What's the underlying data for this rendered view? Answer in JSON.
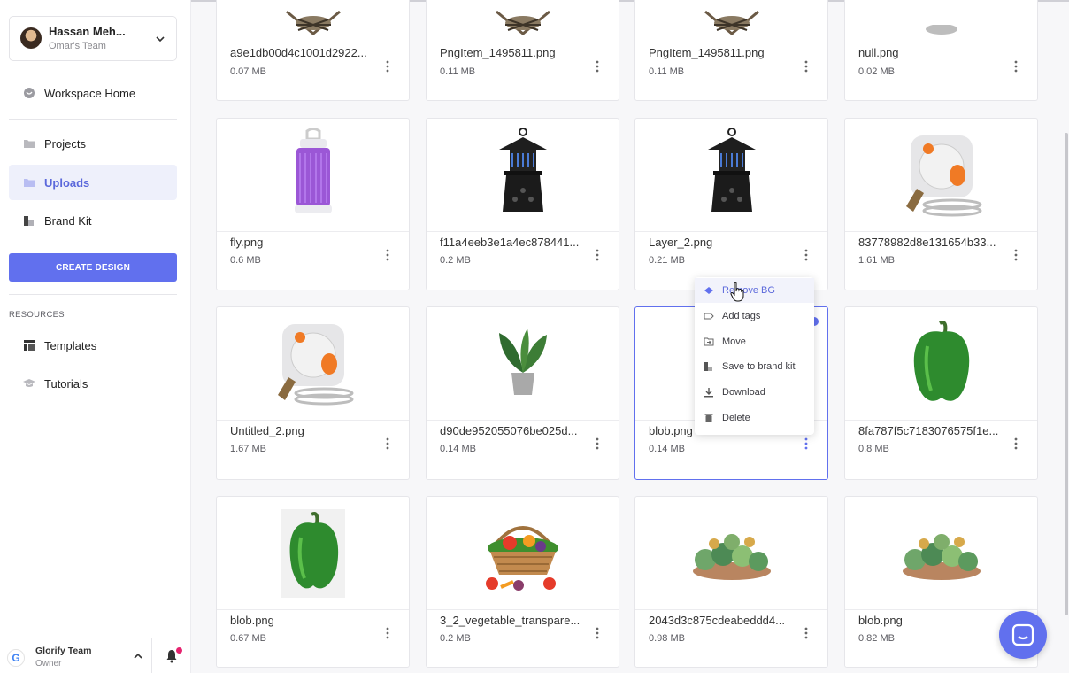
{
  "user": {
    "name": "Hassan Meh...",
    "team": "Omar's Team"
  },
  "nav": {
    "workspace_home": "Workspace Home",
    "projects": "Projects",
    "uploads": "Uploads",
    "brand_kit": "Brand Kit",
    "create_design": "CREATE DESIGN",
    "resources_label": "RESOURCES",
    "templates": "Templates",
    "tutorials": "Tutorials"
  },
  "team": {
    "name": "Glorify Team",
    "role": "Owner",
    "logo_letter": "G"
  },
  "files": [
    {
      "name": "a9e1db00d4c1001d2922...",
      "size": "0.07 MB",
      "thumb": "insect-trap"
    },
    {
      "name": "PngItem_1495811.png",
      "size": "0.11 MB",
      "thumb": "insect-trap"
    },
    {
      "name": "PngItem_1495811.png",
      "size": "0.11 MB",
      "thumb": "insect-trap"
    },
    {
      "name": "null.png",
      "size": "0.02 MB",
      "thumb": "grey-disc"
    },
    {
      "name": "fly.png",
      "size": "0.6 MB",
      "thumb": "uv-lamp"
    },
    {
      "name": "f11a4eeb3e1a4ec878441...",
      "size": "0.2 MB",
      "thumb": "lantern-trap"
    },
    {
      "name": "Layer_2.png",
      "size": "0.21 MB",
      "thumb": "lantern-trap"
    },
    {
      "name": "83778982d8e131654b33...",
      "size": "1.61 MB",
      "thumb": "hose-reel"
    },
    {
      "name": "Untitled_2.png",
      "size": "1.67 MB",
      "thumb": "hose-reel"
    },
    {
      "name": "d90de952055076be025d...",
      "size": "0.14 MB",
      "thumb": "potted-plant"
    },
    {
      "name": "blob.png",
      "size": "0.14 MB",
      "thumb": "empty"
    },
    {
      "name": "8fa787f5c7183076575f1e...",
      "size": "0.8 MB",
      "thumb": "green-pepper"
    },
    {
      "name": "blob.png",
      "size": "0.67 MB",
      "thumb": "green-pepper-boxed"
    },
    {
      "name": "3_2_vegetable_transpare...",
      "size": "0.2 MB",
      "thumb": "vegetable-basket"
    },
    {
      "name": "2043d3c875cdeabeddd4...",
      "size": "0.98 MB",
      "thumb": "succulents"
    },
    {
      "name": "blob.png",
      "size": "0.82 MB",
      "thumb": "succulents"
    }
  ],
  "context_menu": {
    "remove_bg": "Remove BG",
    "add_tags": "Add tags",
    "move": "Move",
    "save_brand_kit": "Save to brand kit",
    "download": "Download",
    "delete": "Delete"
  },
  "colors": {
    "accent": "#6170ee",
    "notification": "#e6236f"
  }
}
